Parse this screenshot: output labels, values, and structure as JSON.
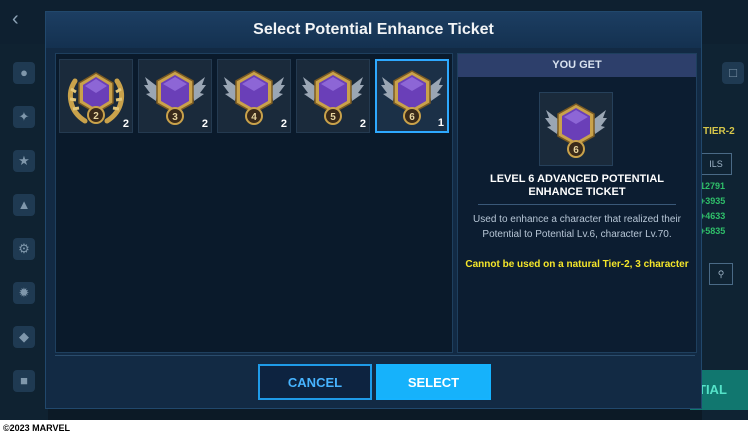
{
  "dialog": {
    "title": "Select Potential Enhance Ticket",
    "cancel_label": "CANCEL",
    "select_label": "SELECT"
  },
  "tickets": [
    {
      "level": "2",
      "count": "2",
      "style": "laurel",
      "selected": false
    },
    {
      "level": "3",
      "count": "2",
      "style": "wings",
      "selected": false
    },
    {
      "level": "4",
      "count": "2",
      "style": "wings",
      "selected": false
    },
    {
      "level": "5",
      "count": "2",
      "style": "wings",
      "selected": false
    },
    {
      "level": "6",
      "count": "1",
      "style": "wings",
      "selected": true
    }
  ],
  "detail": {
    "header": "YOU GET",
    "reward_level": "6",
    "title": "LEVEL 6 ADVANCED POTENTIAL ENHANCE TICKET",
    "description": "Used to enhance a character that realized their Potential to Potential Lv.6, character Lv.70.",
    "warning": "Cannot be used on a natural Tier-2, 3 character"
  },
  "background": {
    "tier_label": "TIER-2",
    "stats": [
      "12791",
      "+3935",
      "+4633",
      "+5835"
    ],
    "button_label": "ILS",
    "bottom_button_label": "TIAL"
  },
  "footer": {
    "copyright": "©2023 MARVEL"
  },
  "colors": {
    "accent": "#16b2fb",
    "warning": "#f5e62a",
    "panel": "#0a1a2b",
    "gem": "#6a3fb8",
    "gold": "#c9a24b"
  }
}
